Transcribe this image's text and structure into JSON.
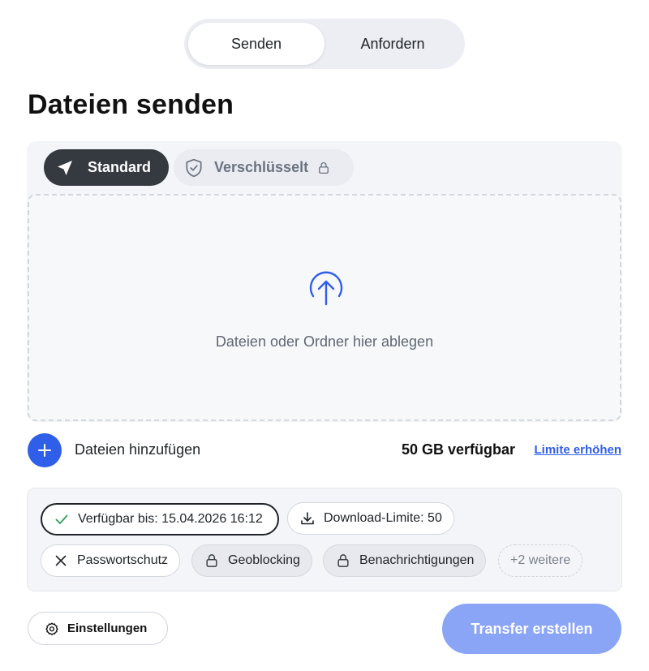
{
  "toggle": {
    "send_label": "Senden",
    "request_label": "Anfordern",
    "active": "send"
  },
  "page": {
    "title": "Dateien senden"
  },
  "modes": {
    "standard_label": "Standard",
    "encrypted_label": "Verschlüsselt",
    "active": "standard"
  },
  "dropzone": {
    "text": "Dateien oder Ordner hier ablegen"
  },
  "files": {
    "add_label": "Dateien hinzufügen",
    "available": "50 GB verfügbar",
    "raise_limit_link": "Limite erhöhen"
  },
  "options": {
    "available_until": "Verfügbar bis: 15.04.2026 16:12",
    "download_limit": "Download-Limite: 50",
    "password": "Passwortschutz",
    "geoblocking": "Geoblocking",
    "notifications": "Benachrichtigungen",
    "more": "+2 weitere"
  },
  "footer": {
    "settings_label": "Einstellungen",
    "create_label": "Transfer erstellen"
  },
  "colors": {
    "accent": "#2f5fe8",
    "primary_disabled": "#8aa4f6",
    "dark": "#343a40",
    "panel": "#f4f5f8"
  }
}
